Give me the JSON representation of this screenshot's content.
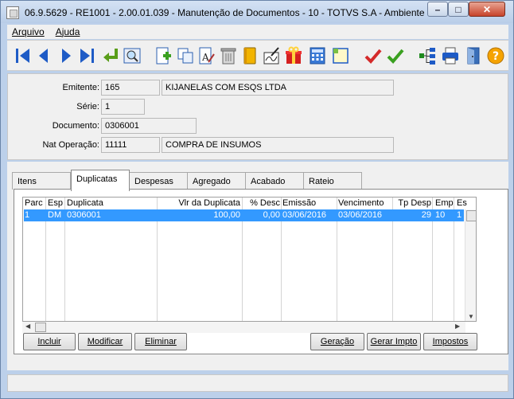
{
  "window": {
    "title": "06.9.5629 - RE1001 - 2.00.01.039 - Manutenção de Documentos - 10 - TOTVS S.A - Ambiente ...",
    "minimize_label": "–",
    "maximize_label": "□",
    "close_label": "✕"
  },
  "menu": {
    "items": [
      {
        "label": "Arquivo"
      },
      {
        "label": "Ajuda"
      }
    ]
  },
  "toolbar": {
    "buttons": [
      {
        "icon": "first-record-icon"
      },
      {
        "icon": "previous-record-icon"
      },
      {
        "icon": "next-record-icon"
      },
      {
        "icon": "last-record-icon"
      },
      {
        "icon": "goto-icon"
      },
      {
        "icon": "search-icon"
      },
      {
        "icon": "new-record-icon"
      },
      {
        "icon": "copy-icon"
      },
      {
        "icon": "edit-icon"
      },
      {
        "icon": "delete-icon"
      },
      {
        "icon": "book-icon"
      },
      {
        "icon": "sign-icon"
      },
      {
        "icon": "gift-icon"
      },
      {
        "icon": "calculator-icon"
      },
      {
        "icon": "note-icon"
      },
      {
        "icon": "confirm-icon"
      },
      {
        "icon": "confirm-all-icon"
      },
      {
        "icon": "tree-icon"
      },
      {
        "icon": "print-icon"
      },
      {
        "icon": "exit-icon"
      },
      {
        "icon": "help-icon"
      }
    ]
  },
  "header": {
    "emitente_label": "Emitente:",
    "emitente_code": "165",
    "emitente_name": "KIJANELAS COM ESQS LTDA",
    "serie_label": "Série:",
    "serie_value": "1",
    "documento_label": "Documento:",
    "documento_value": "0306001",
    "nat_label": "Nat Operação:",
    "nat_code": "11111",
    "nat_desc": "COMPRA DE INSUMOS"
  },
  "tabs": [
    {
      "label": "Itens"
    },
    {
      "label": "Duplicatas"
    },
    {
      "label": "Despesas"
    },
    {
      "label": "Agregado"
    },
    {
      "label": "Acabado"
    },
    {
      "label": "Rateio"
    }
  ],
  "grid": {
    "columns": [
      "Parc",
      "Esp",
      "Duplicata",
      "Vlr da Duplicata",
      "% Desc",
      "Emissão",
      "Vencimento",
      "Tp Desp",
      "Emp",
      "Es"
    ],
    "rows": [
      [
        "1",
        "DM",
        "0306001",
        "100,00",
        "0,00",
        "03/06/2016",
        "03/06/2016",
        "29",
        "10",
        "1"
      ]
    ]
  },
  "buttons": {
    "incluir": "Incluir",
    "modificar": "Modificar",
    "eliminar": "Eliminar",
    "geracao": "Geração",
    "gerar_impto": "Gerar Impto",
    "impostos": "Impostos"
  },
  "colors": {
    "selection": "#3399ff",
    "window_frame": "#bcd0ea"
  }
}
